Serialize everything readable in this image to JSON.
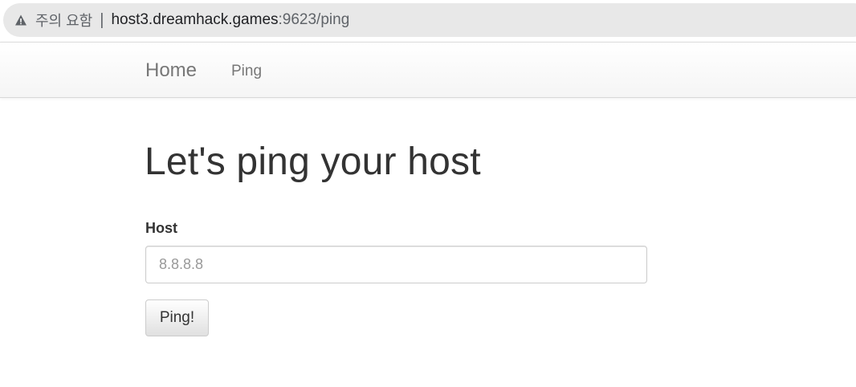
{
  "browser": {
    "security_icon": "warning-triangle-icon",
    "security_text": "주의 요함",
    "separator": "|",
    "url_host": "host3.dreamhack.games",
    "url_rest": ":9623/ping"
  },
  "navbar": {
    "brand": "Home",
    "links": [
      {
        "label": "Ping"
      }
    ]
  },
  "main": {
    "title": "Let's ping your host",
    "host_label": "Host",
    "host_placeholder": "8.8.8.8",
    "submit_label": "Ping!"
  }
}
